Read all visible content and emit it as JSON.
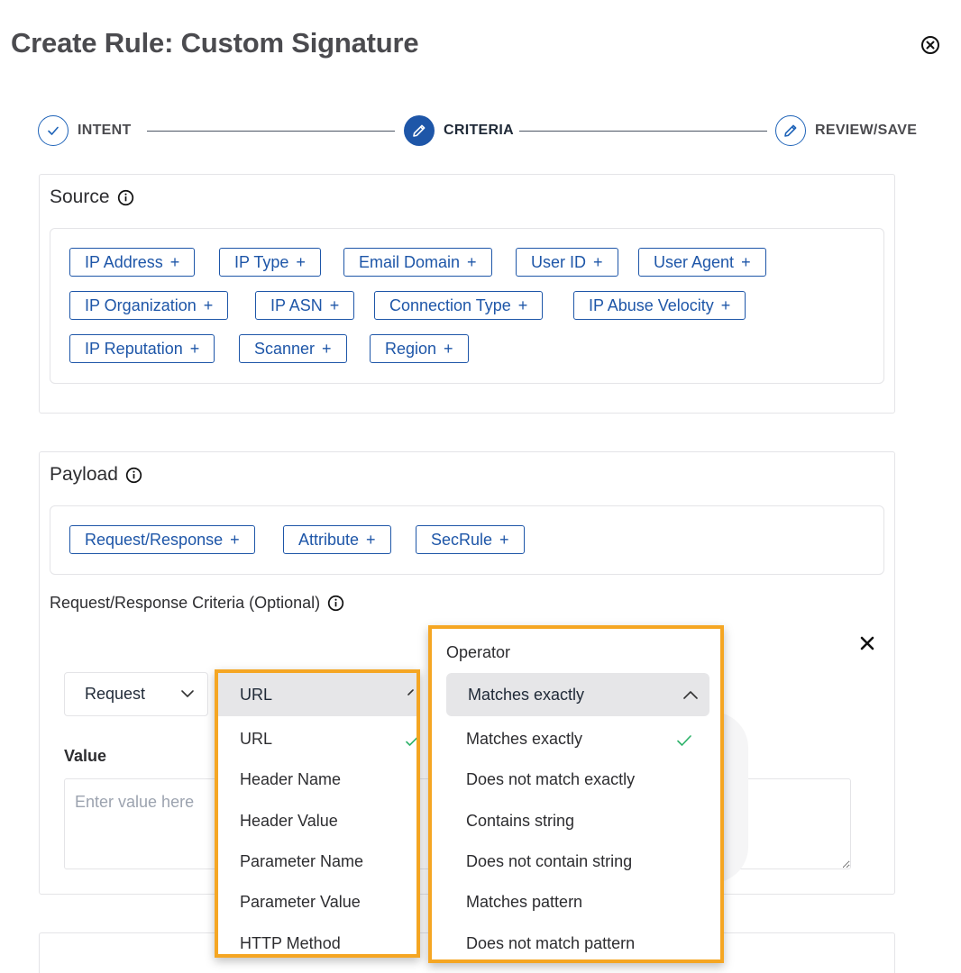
{
  "title": "Create Rule: Custom Signature",
  "stepper": {
    "steps": [
      {
        "label": "INTENT",
        "state": "completed"
      },
      {
        "label": "CRITERIA",
        "state": "active"
      },
      {
        "label": "REVIEW/SAVE",
        "state": "pending"
      }
    ]
  },
  "source": {
    "title": "Source",
    "chips": [
      "IP Address",
      "IP Type",
      "Email Domain",
      "User ID",
      "User Agent",
      "IP Organization",
      "IP ASN",
      "Connection Type",
      "IP Abuse Velocity",
      "IP Reputation",
      "Scanner",
      "Region"
    ]
  },
  "payload": {
    "title": "Payload",
    "chips": [
      "Request/Response",
      "Attribute",
      "SecRule"
    ],
    "criteria_label": "Request/Response Criteria (Optional)"
  },
  "criteria": {
    "scope_value": "Request",
    "field_value": "URL",
    "field_options": [
      "URL",
      "Header Name",
      "Header Value",
      "Parameter Name",
      "Parameter Value",
      "HTTP Method"
    ],
    "operator_caption": "Operator",
    "operator_value": "Matches exactly",
    "operator_options": [
      "Matches exactly",
      "Does not match exactly",
      "Contains string",
      "Does not contain string",
      "Matches pattern",
      "Does not match pattern"
    ],
    "value_label": "Value",
    "value_placeholder": "Enter value here"
  },
  "colors": {
    "accent": "#1e56a8",
    "highlight": "#f5a623",
    "check": "#2fb36b"
  },
  "icons": {
    "close_modal": "circle-x-icon",
    "step_done": "check-icon",
    "step_edit": "pencil-icon",
    "info": "info-icon",
    "remove": "x-icon"
  }
}
